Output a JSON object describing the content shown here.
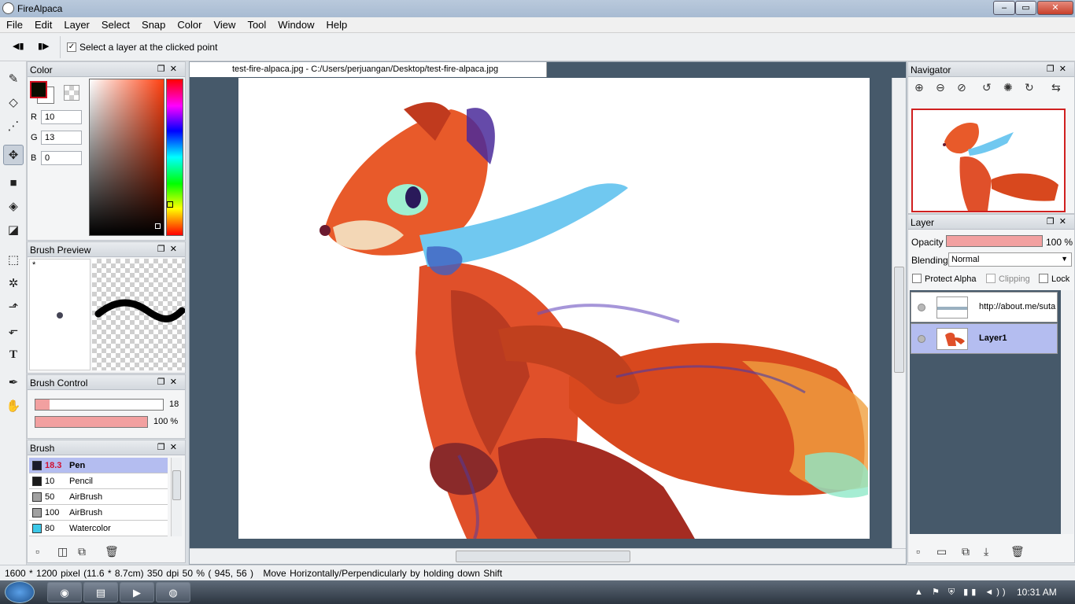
{
  "window": {
    "title": "FireAlpaca",
    "min": "–",
    "max": "▭",
    "close": "✕"
  },
  "menu": [
    "File",
    "Edit",
    "Layer",
    "Select",
    "Snap",
    "Color",
    "View",
    "Tool",
    "Window",
    "Help"
  ],
  "optionbar": {
    "prev": "◀▮",
    "next": "▮▶",
    "checkbox_checked": true,
    "label": "Select a layer at the clicked point"
  },
  "tools": [
    "✎",
    "◇",
    "⋰",
    "✥",
    "■",
    "◈",
    "◪",
    "⬚",
    "✲",
    "⬏",
    "⬐",
    "T",
    "✒",
    "✋"
  ],
  "color_panel": {
    "title": "Color",
    "r_label": "R",
    "r": "10",
    "g_label": "G",
    "g": "13",
    "b_label": "B",
    "b": "0",
    "primary": "#0a0d00",
    "accent": "#d01020"
  },
  "brush_preview": {
    "title": "Brush Preview",
    "marker": "*"
  },
  "brush_control": {
    "title": "Brush Control",
    "size": "18",
    "size_fraction": 0.11,
    "opacity": "100 %",
    "opacity_fraction": 1.0
  },
  "brush_panel": {
    "title": "Brush",
    "items": [
      {
        "size": "18.3",
        "name": "Pen",
        "color": "#1a1a2a"
      },
      {
        "size": "10",
        "name": "Pencil",
        "color": "#1a1a1a"
      },
      {
        "size": "50",
        "name": "AirBrush",
        "color": "#a0a0a0"
      },
      {
        "size": "100",
        "name": "AirBrush",
        "color": "#a0a0a0"
      },
      {
        "size": "80",
        "name": "Watercolor",
        "color": "#3cc8e8"
      }
    ]
  },
  "document": {
    "tab": "test-fire-alpaca.jpg - C:/Users/perjuangan/Desktop/test-fire-alpaca.jpg"
  },
  "navigator": {
    "title": "Navigator",
    "buttons": [
      "⊕",
      "⊖",
      "⊘",
      "↺",
      "✺",
      "↻",
      "⇆"
    ]
  },
  "layer_panel": {
    "title": "Layer",
    "opacity_label": "Opacity",
    "opacity_value": "100 %",
    "opacity_fraction": 1.0,
    "blending_label": "Blending",
    "blending_value": "Normal",
    "protect_alpha": "Protect Alpha",
    "clipping": "Clipping",
    "lock": "Lock",
    "layers": [
      {
        "name": "http://about.me/suta"
      },
      {
        "name": "Layer1"
      }
    ]
  },
  "status": {
    "dims": "1600 * 1200 pixel",
    "size_cm": "(11.6 * 8.7cm)",
    "dpi": "350 dpi",
    "zoom": "50 %",
    "coords": "( 945, 56 )",
    "hint": "Move Horizontally/Perpendicularly by holding down Shift"
  },
  "taskbar": {
    "time": "10:31 AM",
    "tray": "▲ ⚑ ⛨ ▮▮ ◄))"
  }
}
